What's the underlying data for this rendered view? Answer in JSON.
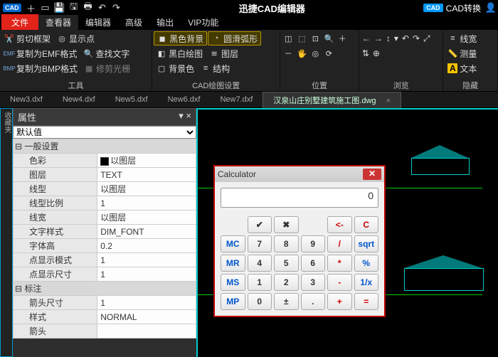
{
  "titlebar": {
    "logo": "CAD",
    "title": "迅捷CAD编辑器",
    "cad_icon": "CAD",
    "cad_convert": "CAD转换"
  },
  "menubar": {
    "file": "文件",
    "tabs": [
      "查看器",
      "编辑器",
      "高级",
      "输出",
      "VIP功能"
    ]
  },
  "ribbon": {
    "group1": {
      "label": "工具",
      "items": [
        "剪切框架",
        "复制为EMF格式",
        "复制为BMP格式",
        "显示点",
        "查找文字",
        "修剪光栅"
      ]
    },
    "group2": {
      "label": "CAD绘图设置",
      "items": [
        "黑色背景",
        "圆滑弧形",
        "黑白绘图",
        "图层",
        "背景色",
        "结构"
      ]
    },
    "group3": {
      "label": "位置"
    },
    "group4": {
      "label": "浏览",
      "items": [
        "线宽",
        "测量",
        "文本"
      ]
    },
    "group5": {
      "label": "隐藏"
    }
  },
  "doctabs": {
    "tabs": [
      "New3.dxf",
      "New4.dxf",
      "New5.dxf",
      "New6.dxf",
      "New7.dxf"
    ],
    "active": "汉泉山庄别墅建筑施工图.dwg"
  },
  "sidebar": {
    "label": "收藏夹"
  },
  "props": {
    "title": "属性",
    "default": "默认值",
    "cat_general": "一般设置",
    "rows": [
      {
        "k": "色彩",
        "v": "以图层",
        "swatch": true
      },
      {
        "k": "图层",
        "v": "TEXT"
      },
      {
        "k": "线型",
        "v": "以图层"
      },
      {
        "k": "线型比例",
        "v": "1"
      },
      {
        "k": "线宽",
        "v": "以图层"
      },
      {
        "k": "文字样式",
        "v": "DIM_FONT"
      },
      {
        "k": "字体高",
        "v": "0.2"
      },
      {
        "k": "点显示模式",
        "v": "1"
      },
      {
        "k": "点显示尺寸",
        "v": "1"
      }
    ],
    "cat_annot": "标注",
    "rows2": [
      {
        "k": "箭头尺寸",
        "v": "1"
      },
      {
        "k": "样式",
        "v": "NORMAL"
      },
      {
        "k": "箭头",
        "v": ""
      }
    ]
  },
  "calc": {
    "title": "Calculator",
    "display": "0",
    "keys": [
      {
        "l": "",
        "cls": "empty"
      },
      {
        "l": "✔"
      },
      {
        "l": "✖"
      },
      {
        "l": "",
        "cls": "empty"
      },
      {
        "l": "<-",
        "cls": "op"
      },
      {
        "l": "C",
        "cls": "op"
      },
      {
        "l": "MC",
        "cls": "mem"
      },
      {
        "l": "7"
      },
      {
        "l": "8"
      },
      {
        "l": "9"
      },
      {
        "l": "/",
        "cls": "op"
      },
      {
        "l": "sqrt",
        "cls": "mem"
      },
      {
        "l": "MR",
        "cls": "mem"
      },
      {
        "l": "4"
      },
      {
        "l": "5"
      },
      {
        "l": "6"
      },
      {
        "l": "*",
        "cls": "op"
      },
      {
        "l": "%",
        "cls": "mem"
      },
      {
        "l": "MS",
        "cls": "mem"
      },
      {
        "l": "1"
      },
      {
        "l": "2"
      },
      {
        "l": "3"
      },
      {
        "l": "-",
        "cls": "op"
      },
      {
        "l": "1/x",
        "cls": "mem"
      },
      {
        "l": "MP",
        "cls": "mem"
      },
      {
        "l": "0"
      },
      {
        "l": "±"
      },
      {
        "l": "."
      },
      {
        "l": "+",
        "cls": "op"
      },
      {
        "l": "=",
        "cls": "op"
      }
    ]
  }
}
